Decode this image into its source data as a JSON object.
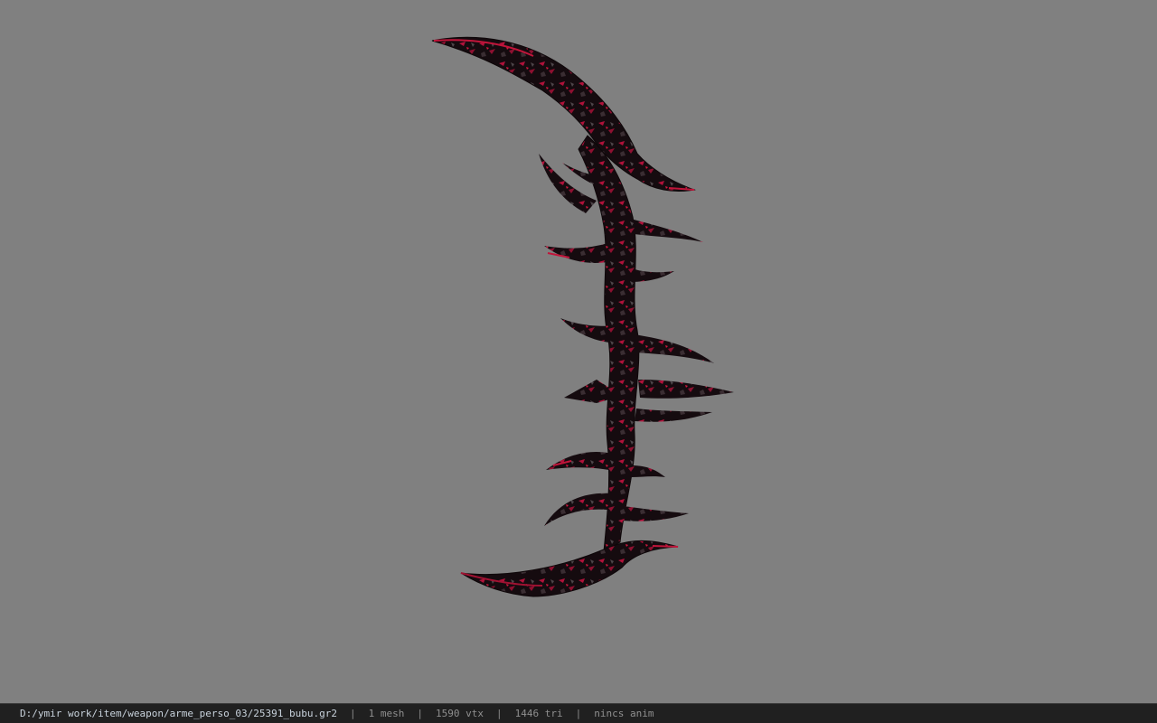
{
  "viewer": {
    "background_color": "#808080",
    "model_subject": "dark spiked crescent blade weapon",
    "model_colors": {
      "base": "#140b0e",
      "mid": "#2a1a1f",
      "accent": "#c0153a",
      "highlight": "#6a6266"
    }
  },
  "statusbar": {
    "file_path": "D:/ymir work/item/weapon/arme_perso_03/25391_bubu.gr2",
    "separator": "|",
    "mesh_count": "1 mesh",
    "vertex_count": "1590 vtx",
    "triangle_count": "1446 tri",
    "animation": "nincs anim"
  }
}
